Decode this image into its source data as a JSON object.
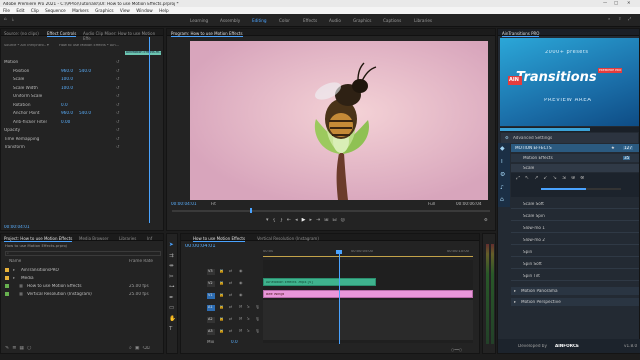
{
  "window": {
    "title": "Adobe Premiere Pro 2021 - C:\\\\PPro\\\\Tutorials\\\\UI: How to use Motion Effects.prproj *"
  },
  "menu": [
    "File",
    "Edit",
    "Clip",
    "Sequence",
    "Markers",
    "Graphics",
    "View",
    "Window",
    "Help"
  ],
  "workspaces": [
    "Learning",
    "Assembly",
    "Editing",
    "Color",
    "Effects",
    "Audio",
    "Graphics",
    "Captions",
    "Libraries"
  ],
  "source": {
    "tabs": [
      "Source: (no clips)",
      "Effect Controls",
      "Audio Clip Mixer: How to use Motion Effe"
    ],
    "clip_label": "Source * AinTRM(Intro.. ▾",
    "seq_label": "How to use Motion Effects * Aln...",
    "clip_bar": "AinMotion Effects.m...",
    "rows": [
      {
        "label": "Motion",
        "value": "",
        "value2": ""
      },
      {
        "label": "Position",
        "value": "960.0",
        "value2": "540.0"
      },
      {
        "label": "Scale",
        "value": "100.0",
        "value2": ""
      },
      {
        "label": "Scale Width",
        "value": "100.0",
        "value2": ""
      },
      {
        "label": "Uniform Scale",
        "value": "",
        "value2": ""
      },
      {
        "label": "Rotation",
        "value": "0.0",
        "value2": ""
      },
      {
        "label": "Anchor Point",
        "value": "960.0",
        "value2": "540.0"
      },
      {
        "label": "Anti-flicker Filter",
        "value": "0.00",
        "value2": ""
      },
      {
        "label": "Opacity",
        "value": "",
        "value2": ""
      },
      {
        "label": "Time Remapping",
        "value": "",
        "value2": ""
      },
      {
        "label": "Transform",
        "value": "",
        "value2": ""
      }
    ],
    "timecode": "00:00:04:01"
  },
  "program": {
    "tab": "Program: How to use Motion Effects",
    "timecode_in": "00:00:04:01",
    "fit": "Fit",
    "quality": "Full",
    "timecode_out": "00:00:06:04",
    "controls": [
      "marker",
      "in",
      "out",
      "go-to-in",
      "step-back",
      "play",
      "step-forward",
      "go-to-out",
      "insert",
      "overwrite",
      "export-frame",
      "settings"
    ]
  },
  "project": {
    "tabs": [
      "Project: How to use Motion Effects",
      "Media Browser",
      "Libraries",
      "Inf"
    ],
    "path": "How to use Motion Effects.prproj",
    "columns": [
      "Name",
      "Frame Rate"
    ],
    "items": [
      {
        "name": "AinTransitionsPRO",
        "rate": "",
        "color": "#e8b33a"
      },
      {
        "name": "Media",
        "rate": "",
        "color": "#e8b33a"
      },
      {
        "name": "How to use Motion Effects",
        "rate": "25.00 fps",
        "color": "#67b14f"
      },
      {
        "name": "Vertical Resolution (Instagram)",
        "rate": "25.00 fps",
        "color": "#67b14f"
      }
    ]
  },
  "timeline": {
    "tabs": [
      "How to use Motion Effects",
      "Vertical Resolution (Instagram)"
    ],
    "timecode": "00:00:04:01",
    "ruler": [
      "00:00",
      "00:00:05:00",
      "00:00:10:00"
    ],
    "video_tracks": [
      "V3",
      "V2",
      "V1"
    ],
    "audio_tracks": [
      "A1",
      "A2",
      "A3"
    ],
    "master": "Mix",
    "master_val": "0.0",
    "clips": [
      {
        "label": "AinMotion Effects .mp4 [V]",
        "track": "V2",
        "color": "#3fb38e"
      },
      {
        "label": "Bee Wings",
        "track": "V1",
        "color": "#e896d9"
      }
    ]
  },
  "ain": {
    "header": "AinTransitions PRO",
    "preview": {
      "count": "2000+ presets",
      "logo": "Transitions",
      "badge": "PREMIERE PRO",
      "sub": "PREVIEW AREA"
    },
    "advanced": "Advanced Settings",
    "categories": [
      {
        "label": "MOTION EFFECTS",
        "badge": "127"
      },
      {
        "label": "Motion Effects",
        "badge": "35"
      },
      {
        "label": "Scale",
        "badge": ""
      }
    ],
    "scale_items": [
      "Scale Soft",
      "Scale Spin",
      "Slow-mo 1",
      "Slow-mo 2",
      "Spin",
      "Spin Soft",
      "Spin Tilt"
    ],
    "groups": [
      "Motion Panorama",
      "Motion Perspective"
    ],
    "footer": {
      "dev": "Developed by",
      "brand": "AINFORCE",
      "version": "v1.8.0"
    }
  }
}
